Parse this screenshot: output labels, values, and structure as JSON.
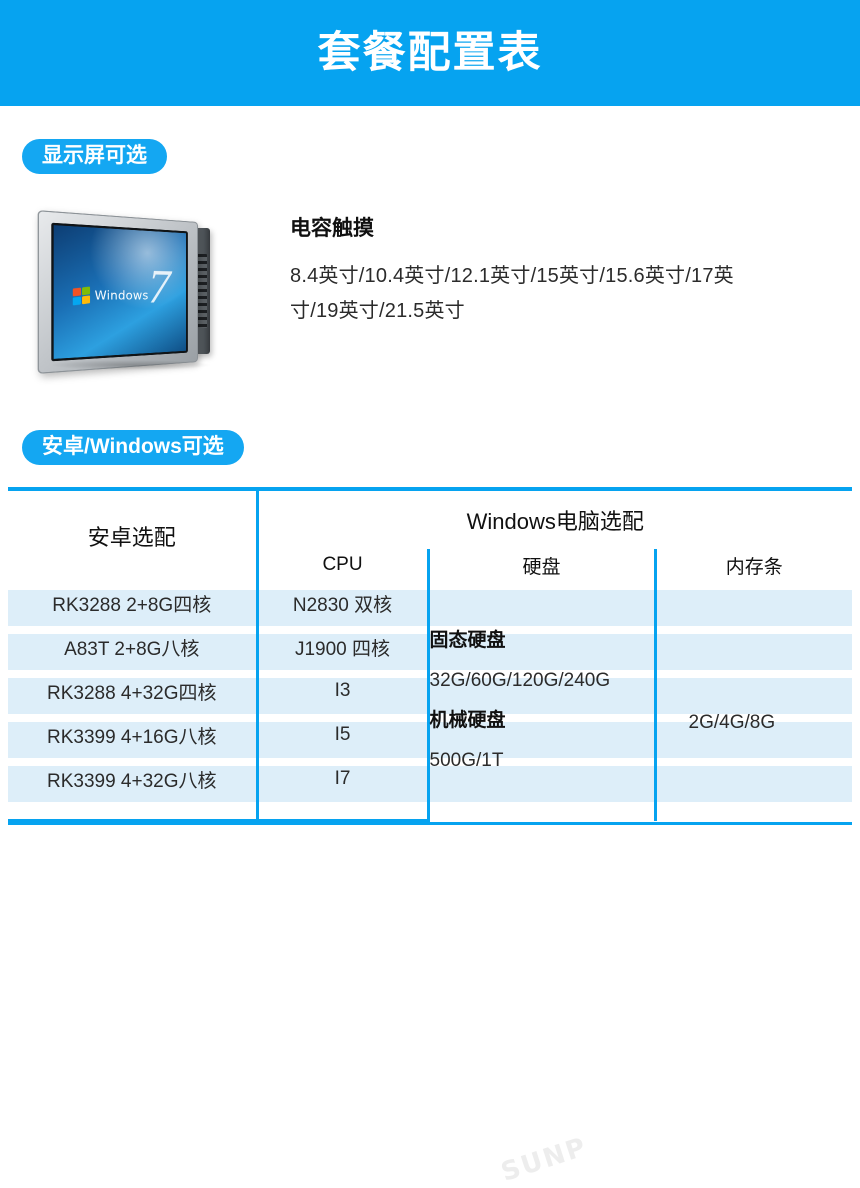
{
  "header": {
    "title": "套餐配置表",
    "bg_color": "#06a3f0",
    "text_color": "#ffffff"
  },
  "sections": {
    "display": {
      "badge": "显示屏可选",
      "device_image_alt": "Windows 工业平板电脑",
      "device_screen_label": "Windows",
      "device_screen_version": "7",
      "touch_heading": "电容触摸",
      "sizes": "8.4英寸/10.4英寸/12.1英寸/15英寸/15.6英寸/17英寸/19英寸/21.5英寸"
    },
    "os": {
      "badge": "安卓/Windows可选"
    }
  },
  "table": {
    "header_primary": {
      "android": "安卓选配",
      "windows": "Windows电脑选配"
    },
    "header_sub": {
      "cpu": "CPU",
      "disk": "硬盘",
      "memory": "内存条"
    },
    "android_options": [
      "RK3288  2+8G四核",
      "A83T      2+8G八核",
      "RK3288  4+32G四核",
      "RK3399  4+16G八核",
      "RK3399  4+32G八核"
    ],
    "cpu_options": [
      "N2830  双核",
      "J1900   四核",
      "I3",
      "I5",
      "I7"
    ],
    "disk": {
      "ssd_label": "固态硬盘",
      "ssd_values": "32G/60G/120G/240G",
      "hdd_label": "机械硬盘",
      "hdd_values": "500G/1T"
    },
    "memory": {
      "values": "2G/4G/8G"
    },
    "accent_color": "#06a3f0",
    "stripe_color": "#ddeef9"
  },
  "watermark": {
    "text": "SUNP"
  }
}
